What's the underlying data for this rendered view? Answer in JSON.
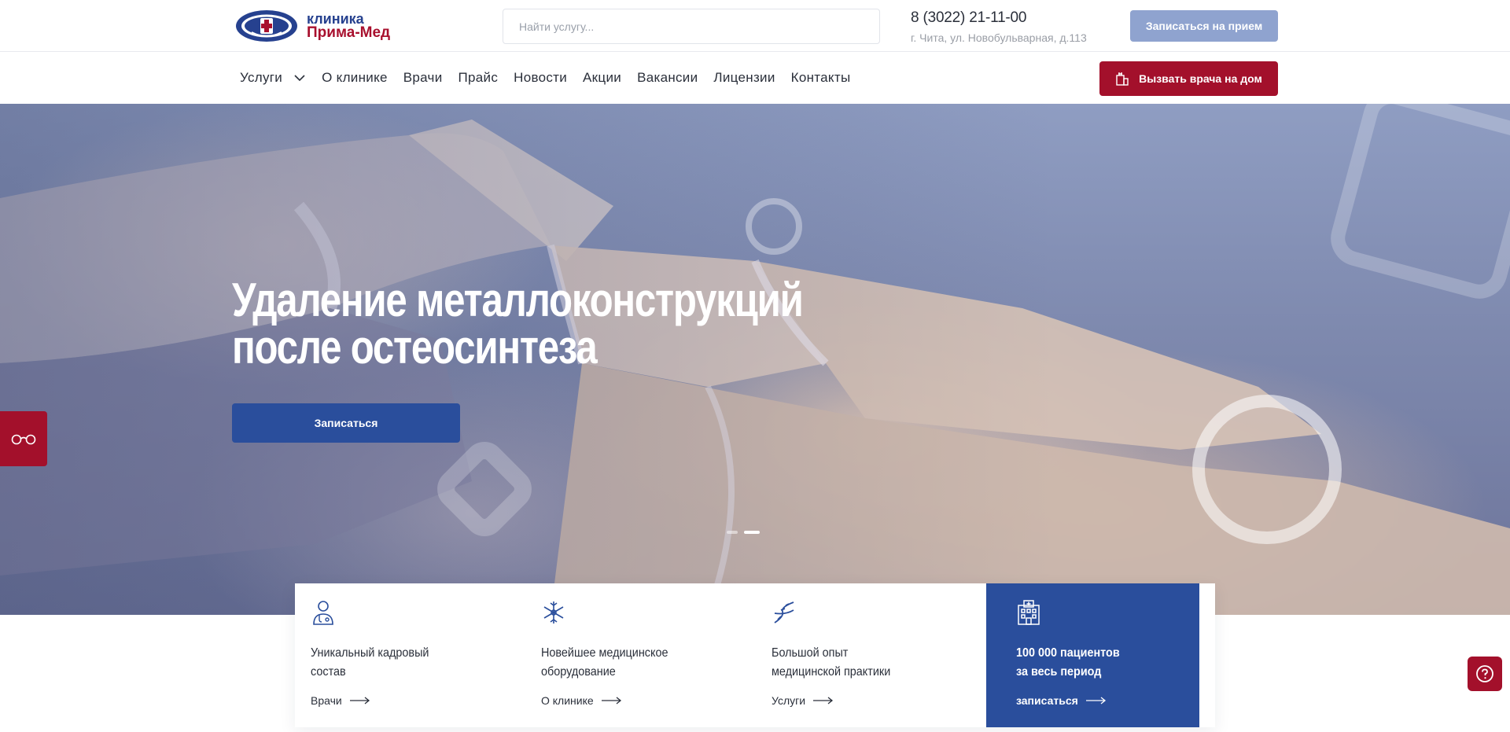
{
  "header": {
    "logo": {
      "line1": "клиника",
      "line2": "Прима-Мед"
    },
    "search": {
      "placeholder": "Найти услугу..."
    },
    "phone": "8 (3022) 21-11-00",
    "address": "г. Чита, ул. Новобульварная, д.113",
    "appoint_button": "Записаться на прием"
  },
  "nav": {
    "items": [
      "Услуги",
      "О клинике",
      "Врачи",
      "Прайс",
      "Новости",
      "Акции",
      "Вакансии",
      "Лицензии",
      "Контакты"
    ],
    "house_call_button": "Вызвать врача на дом"
  },
  "hero": {
    "title_line1": "Удаление металлоконструкций",
    "title_line2": "после остеосинтеза",
    "button": "Записаться",
    "slides_total": 2,
    "active_slide": 2
  },
  "features": [
    {
      "title": "Уникальный кадровый состав",
      "link": "Врачи",
      "icon": "doctor-icon"
    },
    {
      "title": "Новейшее медицинское оборудование",
      "link": "О клинике",
      "icon": "snowflake-icon"
    },
    {
      "title": "Большой опыт медицинской практики",
      "link": "Услуги",
      "icon": "dna-icon"
    },
    {
      "title_line1": "100 000 пациентов",
      "title_line2": "за весь период",
      "link": "записаться",
      "icon": "hospital-icon"
    }
  ],
  "colors": {
    "brand_blue": "#2a4e9c",
    "brand_red": "#a3102b",
    "appoint_button": "#8fa3cf"
  }
}
